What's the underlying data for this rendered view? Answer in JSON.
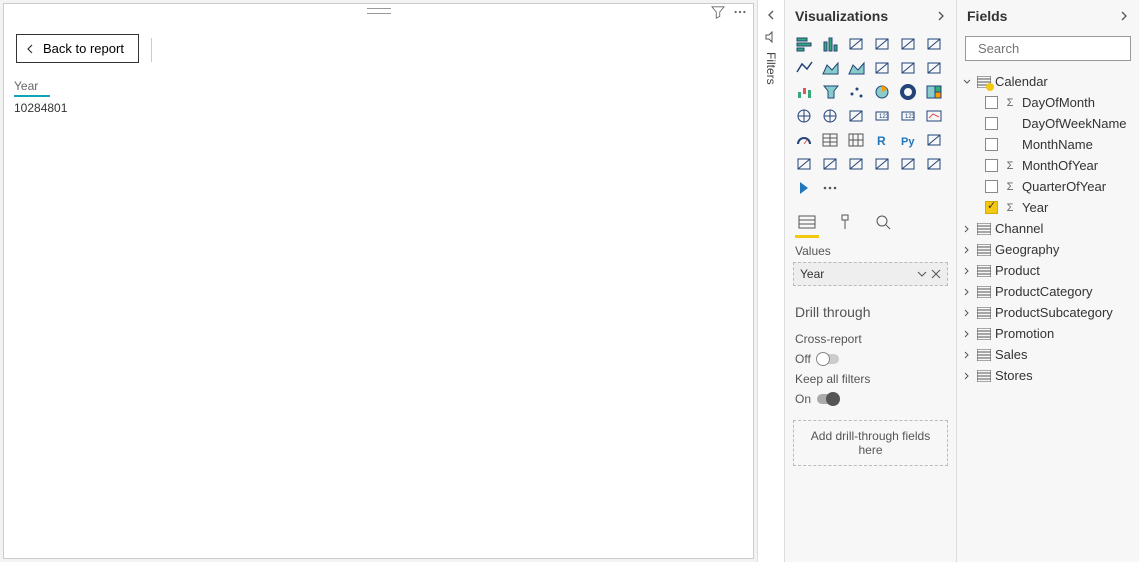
{
  "canvas": {
    "back_label": "Back to report",
    "card_label": "Year",
    "card_value": "10284801"
  },
  "filters_rail": {
    "label": "Filters"
  },
  "viz": {
    "title": "Visualizations",
    "icons": [
      "stacked-bar",
      "stacked-column",
      "clustered-bar",
      "clustered-column",
      "hundred-bar",
      "hundred-column",
      "line",
      "area",
      "stacked-area",
      "line-stacked",
      "line-clustered",
      "ribbon",
      "waterfall",
      "funnel",
      "scatter",
      "pie",
      "donut",
      "treemap",
      "map",
      "filled-map",
      "arcgis",
      "card",
      "multi-row-card",
      "kpi",
      "gauge",
      "table",
      "matrix",
      "r-visual",
      "py-visual",
      "key-influencers",
      "decomposition",
      "qna",
      "paginated",
      "powerapps",
      "custom1",
      "custom2",
      "get-more",
      "more-dots"
    ],
    "values_label": "Values",
    "values_field": "Year",
    "drill_title": "Drill through",
    "cross_report_label": "Cross-report",
    "cross_report_state": "Off",
    "keep_filters_label": "Keep all filters",
    "keep_filters_state": "On",
    "drill_drop_label": "Add drill-through fields here"
  },
  "fields": {
    "title": "Fields",
    "search_placeholder": "Search",
    "tables": [
      {
        "name": "Calendar",
        "expanded": true,
        "marked": true,
        "fields": [
          {
            "name": "DayOfMonth",
            "sigma": true,
            "checked": false
          },
          {
            "name": "DayOfWeekName",
            "sigma": false,
            "checked": false
          },
          {
            "name": "MonthName",
            "sigma": false,
            "checked": false
          },
          {
            "name": "MonthOfYear",
            "sigma": true,
            "checked": false
          },
          {
            "name": "QuarterOfYear",
            "sigma": true,
            "checked": false
          },
          {
            "name": "Year",
            "sigma": true,
            "checked": true
          }
        ]
      },
      {
        "name": "Channel",
        "expanded": false
      },
      {
        "name": "Geography",
        "expanded": false
      },
      {
        "name": "Product",
        "expanded": false
      },
      {
        "name": "ProductCategory",
        "expanded": false
      },
      {
        "name": "ProductSubcategory",
        "expanded": false
      },
      {
        "name": "Promotion",
        "expanded": false
      },
      {
        "name": "Sales",
        "expanded": false
      },
      {
        "name": "Stores",
        "expanded": false
      }
    ]
  }
}
